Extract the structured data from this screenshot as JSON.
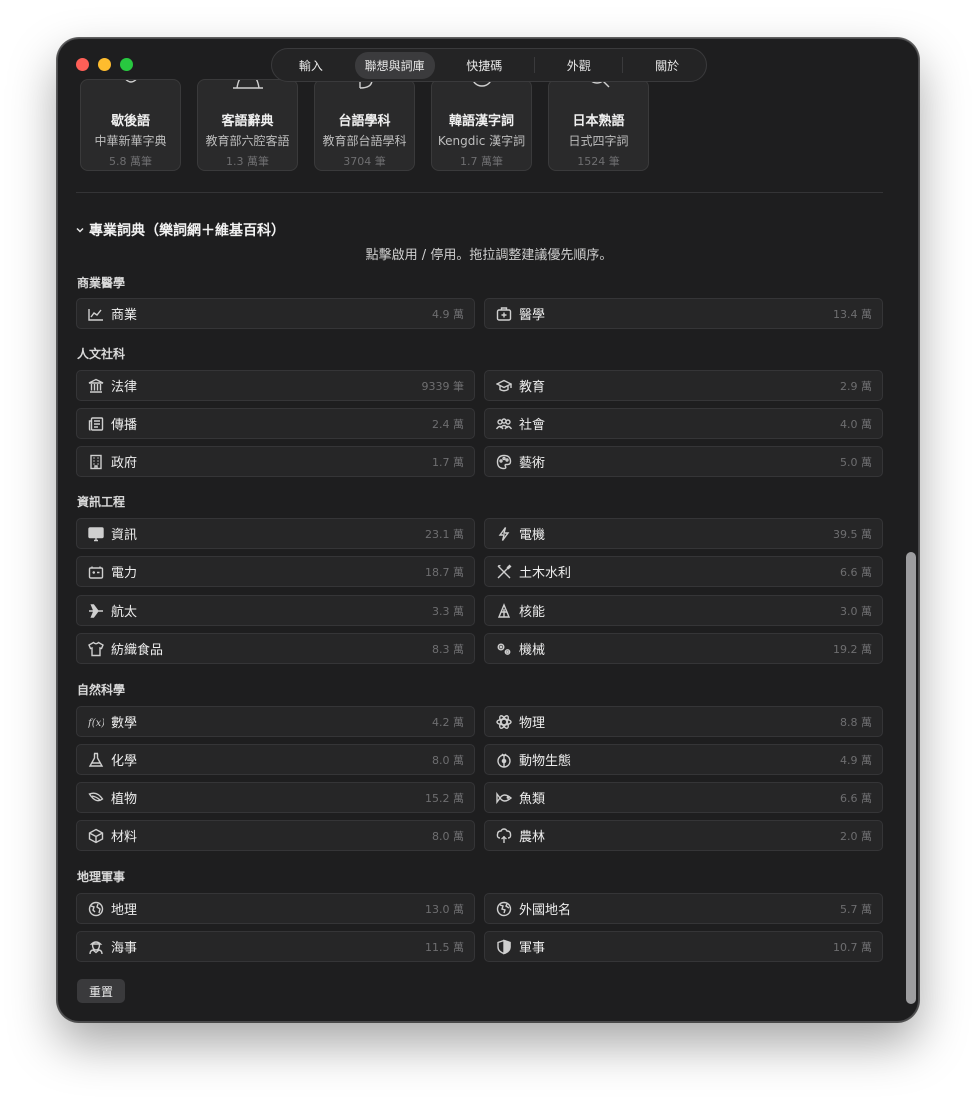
{
  "toolbar": {
    "tabs": [
      "輸入",
      "聯想與詞庫",
      "快捷碼",
      "外觀",
      "關於"
    ],
    "active": "聯想與詞庫"
  },
  "top_cards": [
    {
      "title": "歇後語",
      "sub": "中華新華字典",
      "count": "5.8 萬筆"
    },
    {
      "title": "客語辭典",
      "sub": "教育部六腔客語",
      "count": "1.3 萬筆"
    },
    {
      "title": "台語學科",
      "sub": "教育部台語學科",
      "count": "3704 筆"
    },
    {
      "title": "韓語漢字詞",
      "sub": "Kengdic 漢字詞",
      "count": "1.7 萬筆"
    },
    {
      "title": "日本熟語",
      "sub": "日式四字詞",
      "count": "1524 筆"
    }
  ],
  "section": {
    "title": "專業詞典（樂詞網＋維基百科）",
    "hint": "點擊啟用 / 停用。拖拉調整建議優先順序。"
  },
  "groups": [
    {
      "label": "商業醫學",
      "items": [
        {
          "icon": "chart-line-icon",
          "label": "商業",
          "count": "4.9 萬"
        },
        {
          "icon": "medkit-icon",
          "label": "醫學",
          "count": "13.4 萬"
        }
      ]
    },
    {
      "label": "人文社科",
      "items": [
        {
          "icon": "bank-icon",
          "label": "法律",
          "count": "9339 筆"
        },
        {
          "icon": "graduation-cap-icon",
          "label": "教育",
          "count": "2.9 萬"
        },
        {
          "icon": "newspaper-icon",
          "label": "傳播",
          "count": "2.4 萬"
        },
        {
          "icon": "people-icon",
          "label": "社會",
          "count": "4.0 萬"
        },
        {
          "icon": "building-icon",
          "label": "政府",
          "count": "1.7 萬"
        },
        {
          "icon": "palette-icon",
          "label": "藝術",
          "count": "5.0 萬"
        }
      ]
    },
    {
      "label": "資訊工程",
      "items": [
        {
          "icon": "monitor-icon",
          "label": "資訊",
          "count": "23.1 萬"
        },
        {
          "icon": "bolt-icon",
          "label": "電機",
          "count": "39.5 萬"
        },
        {
          "icon": "battery-icon",
          "label": "電力",
          "count": "18.7 萬"
        },
        {
          "icon": "tools-icon",
          "label": "土木水利",
          "count": "6.6 萬"
        },
        {
          "icon": "airplane-icon",
          "label": "航太",
          "count": "3.3 萬"
        },
        {
          "icon": "atom-hazard-icon",
          "label": "核能",
          "count": "3.0 萬"
        },
        {
          "icon": "tshirt-icon",
          "label": "紡織食品",
          "count": "8.3 萬"
        },
        {
          "icon": "gears-icon",
          "label": "機械",
          "count": "19.2 萬"
        }
      ]
    },
    {
      "label": "自然科學",
      "items": [
        {
          "icon": "function-icon",
          "label": "數學",
          "count": "4.2 萬"
        },
        {
          "icon": "atom-icon",
          "label": "物理",
          "count": "8.8 萬"
        },
        {
          "icon": "flask-icon",
          "label": "化學",
          "count": "8.0 萬"
        },
        {
          "icon": "ladybug-icon",
          "label": "動物生態",
          "count": "4.9 萬"
        },
        {
          "icon": "leaf-icon",
          "label": "植物",
          "count": "15.2 萬"
        },
        {
          "icon": "fish-icon",
          "label": "魚類",
          "count": "6.6 萬"
        },
        {
          "icon": "cube-icon",
          "label": "材料",
          "count": "8.0 萬"
        },
        {
          "icon": "tree-icon",
          "label": "農林",
          "count": "2.0 萬"
        }
      ]
    },
    {
      "label": "地理軍事",
      "items": [
        {
          "icon": "globe-icon",
          "label": "地理",
          "count": "13.0 萬"
        },
        {
          "icon": "globe-alt-icon",
          "label": "外國地名",
          "count": "5.7 萬"
        },
        {
          "icon": "sailor-icon",
          "label": "海事",
          "count": "11.5 萬"
        },
        {
          "icon": "shield-icon",
          "label": "軍事",
          "count": "10.7 萬"
        }
      ]
    }
  ],
  "reset_label": "重置"
}
